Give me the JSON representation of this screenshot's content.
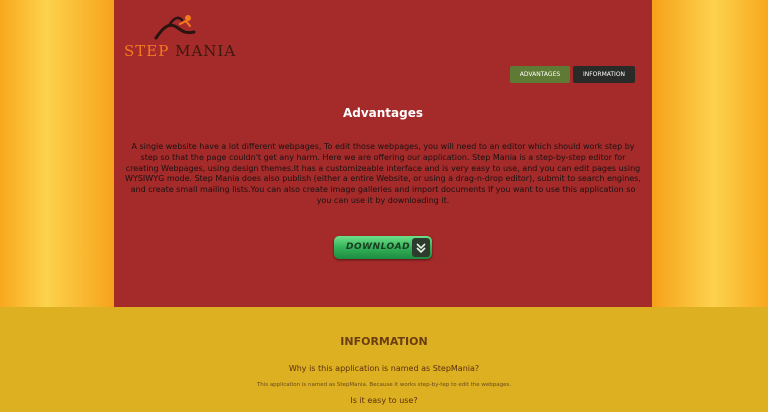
{
  "logo": {
    "word1": "Step",
    "word2": "Mania",
    "icon": "running-figure-icon"
  },
  "nav": {
    "advantages": "ADVANTAGES",
    "information": "INFORMATION"
  },
  "advantages": {
    "title": "Advantages",
    "text": "A single website have a lot different webpages, To edit those webpages, you will need to an editor which should work step by step so that the page couldn't get any harm. Here we are offering our application. Step Mania is a step-by-step editor for creating Webpages, using design themes.It has a customizeable interface and is very easy to use, and you can edit pages using WYSIWYG mode. Step Mania does also publish (either a entire Website, or using a drag-n-drop editor), submit to search engines, and create small mailing lists.You can also create image galleries and import documents If you want to use this application so you can use it by downloading it."
  },
  "download": {
    "label": "DOWNLOAD",
    "icon": "double-chevron-down-icon"
  },
  "information": {
    "title": "INFORMATION",
    "question1": "Why is this application is named as StepMania?",
    "answer1": "This application is named as StepMania. Because it works step-by-tep to edit the webpages.",
    "question2": "Is it easy to use?"
  },
  "colors": {
    "panel": "#a52a2a",
    "background": "#f7a91a",
    "info_band": "#ddb022",
    "nav_advantages": "#5f7a34",
    "nav_information": "#2a2a28",
    "download_green": "#34b25a"
  }
}
